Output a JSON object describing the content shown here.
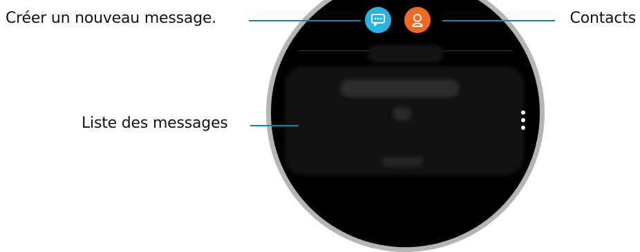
{
  "annotations": {
    "new_message": "Créer un nouveau message.",
    "contacts": "Contacts",
    "message_list": "Liste des messages"
  },
  "colors": {
    "leader_line": "#1a7fb4",
    "compose_button": "#29b5e4",
    "contacts_button": "#ee6a22",
    "screen_background": "#000000"
  },
  "icons": {
    "compose": "speech-bubble-dots-icon",
    "contacts": "person-outline-icon",
    "more": "vertical-ellipsis-icon"
  }
}
